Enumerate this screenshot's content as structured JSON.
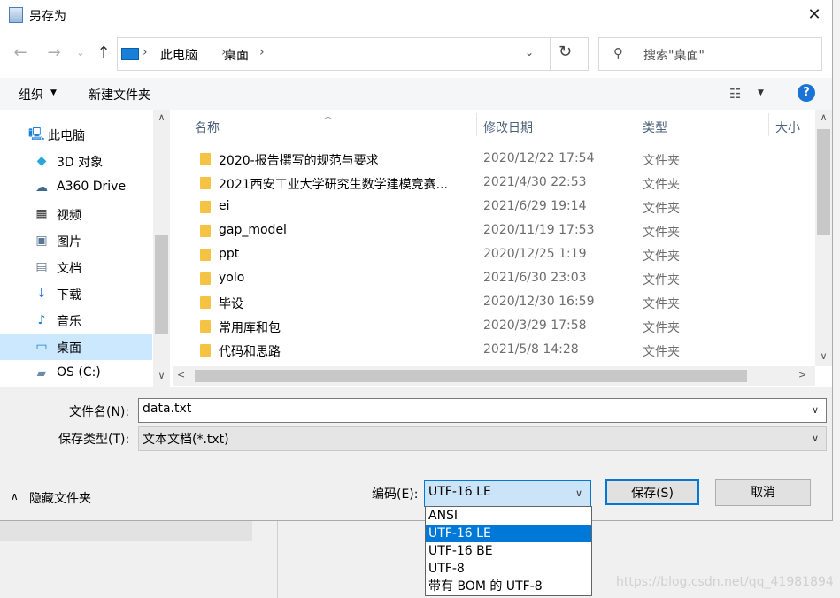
{
  "window": {
    "title": "另存为",
    "close_glyph": "✕"
  },
  "address": {
    "crumbs": [
      "此电脑",
      "桌面"
    ],
    "search_placeholder": "搜索\"桌面\""
  },
  "toolbar": {
    "organize": "组织",
    "new_folder": "新建文件夹"
  },
  "sidebar": {
    "items": [
      {
        "label": "此电脑",
        "icon": "computer-icon",
        "glyph": "🖳"
      },
      {
        "label": "3D 对象",
        "icon": "3d-objects-icon",
        "glyph": "◆"
      },
      {
        "label": "A360 Drive",
        "icon": "a360-drive-icon",
        "glyph": "☁"
      },
      {
        "label": "视频",
        "icon": "video-icon",
        "glyph": "▦"
      },
      {
        "label": "图片",
        "icon": "pictures-icon",
        "glyph": "▣"
      },
      {
        "label": "文档",
        "icon": "documents-icon",
        "glyph": "▤"
      },
      {
        "label": "下载",
        "icon": "download-icon",
        "glyph": "↓"
      },
      {
        "label": "音乐",
        "icon": "music-icon",
        "glyph": "♪"
      },
      {
        "label": "桌面",
        "icon": "desktop-icon",
        "glyph": "▭",
        "selected": true
      },
      {
        "label": "OS (C:)",
        "icon": "drive-icon",
        "glyph": "▰"
      }
    ]
  },
  "file_list": {
    "columns": {
      "name": "名称",
      "modified": "修改日期",
      "type": "类型",
      "size": "大小"
    },
    "rows": [
      {
        "name": "2020-报告撰写的规范与要求",
        "modified": "2020/12/22 17:54",
        "type": "文件夹"
      },
      {
        "name": "2021西安工业大学研究生数学建模竞赛...",
        "modified": "2021/4/30 22:53",
        "type": "文件夹"
      },
      {
        "name": "ei",
        "modified": "2021/6/29 19:14",
        "type": "文件夹"
      },
      {
        "name": "gap_model",
        "modified": "2020/11/19 17:53",
        "type": "文件夹"
      },
      {
        "name": "ppt",
        "modified": "2020/12/25 1:19",
        "type": "文件夹"
      },
      {
        "name": "yolo",
        "modified": "2021/6/30 23:03",
        "type": "文件夹"
      },
      {
        "name": "毕设",
        "modified": "2020/12/30 16:59",
        "type": "文件夹"
      },
      {
        "name": "常用库和包",
        "modified": "2020/3/29 17:58",
        "type": "文件夹"
      },
      {
        "name": "代码和思路",
        "modified": "2021/5/8 14:28",
        "type": "文件夹"
      }
    ]
  },
  "form": {
    "filename_label": "文件名(N):",
    "filename_value": "data.txt",
    "filetype_label": "保存类型(T):",
    "filetype_value": "文本文档(*.txt)",
    "hide_folders": "隐藏文件夹",
    "encoding_label": "编码(E):",
    "encoding_value": "UTF-16 LE",
    "encoding_options": [
      "ANSI",
      "UTF-16 LE",
      "UTF-16 BE",
      "UTF-8",
      "带有 BOM 的 UTF-8"
    ],
    "save_button": "保存(S)",
    "cancel_button": "取消"
  },
  "watermark": "https://blog.csdn.net/qq_41981894"
}
